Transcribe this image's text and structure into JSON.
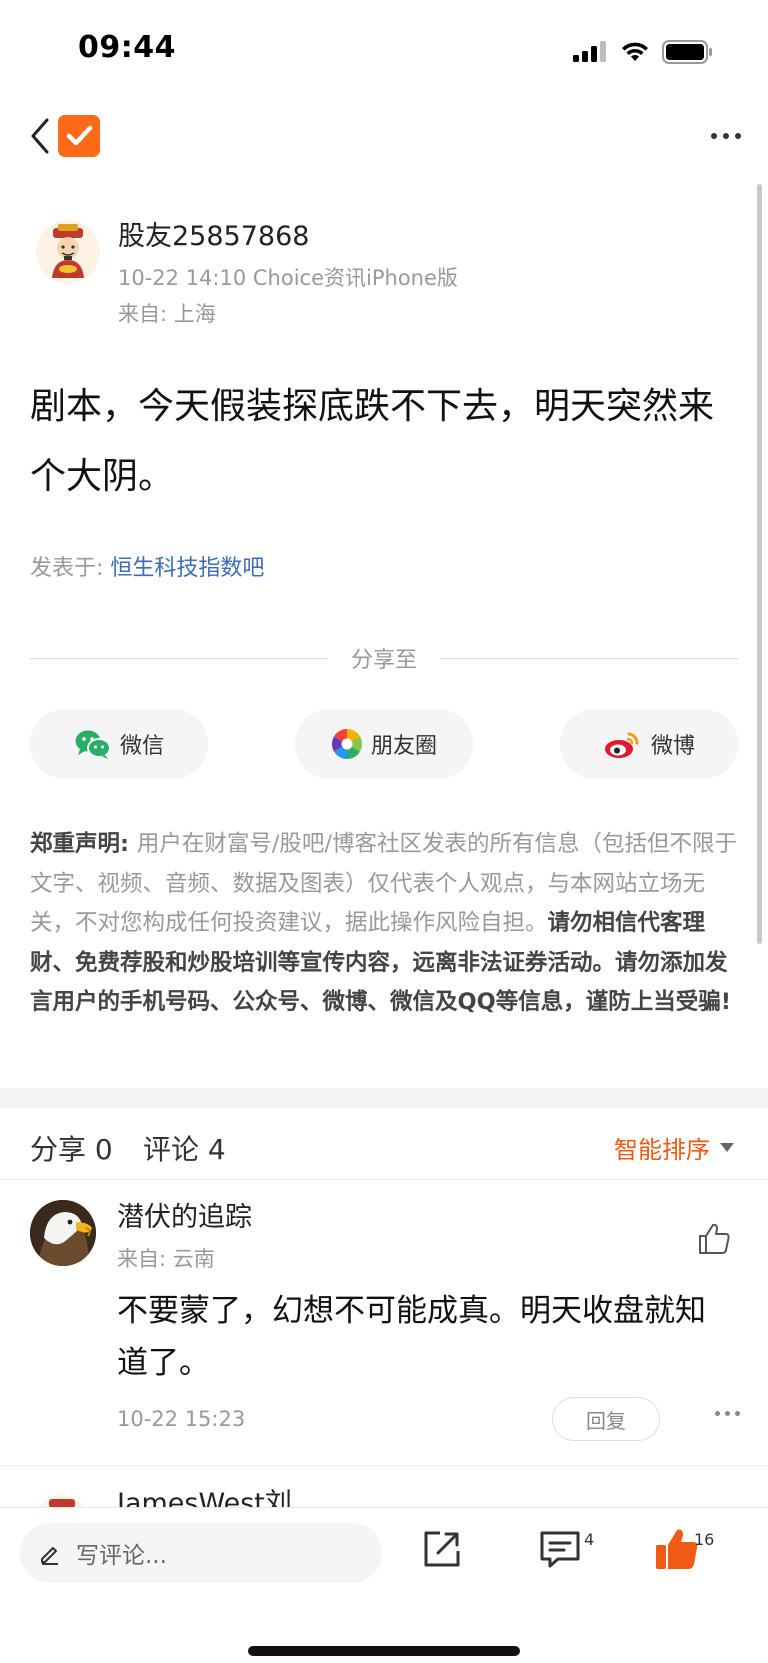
{
  "status_bar": {
    "time": "09:44"
  },
  "nav": {
    "back_icon": "chevron-left-icon",
    "logo_icon": "checkmark-logo-icon",
    "more_icon": "more-horizontal-icon"
  },
  "post": {
    "username": "股友25857868",
    "meta": "10-22 14:10 Choice资讯iPhone版",
    "location": "来自: 上海",
    "body": "剧本，今天假装探底跌不下去，明天突然来个大阴。",
    "posted_in_label": "发表于: ",
    "forum": "恒生科技指数吧"
  },
  "share": {
    "label": "分享至",
    "wechat": "微信",
    "moments": "朋友圈",
    "weibo": "微博"
  },
  "disclaimer": {
    "title": "郑重声明: ",
    "normal": "用户在财富号/股吧/博客社区发表的所有信息（包括但不限于文字、视频、音频、数据及图表）仅代表个人观点，与本网站立场无关，不对您构成任何投资建议，据此操作风险自担。",
    "bold": "请勿相信代客理财、免费荐股和炒股培训等宣传内容，远离非法证券活动。请勿添加发言用户的手机号码、公众号、微博、微信及QQ等信息，谨防上当受骗!"
  },
  "comments_header": {
    "share_count": "分享 0",
    "comment_count": "评论 4",
    "sort_label": "智能排序"
  },
  "comments": [
    {
      "username": "潜伏的追踪",
      "location": "来自: 云南",
      "text": "不要蒙了，幻想不可能成真。明天收盘就知道了。",
      "time": "10-22 15:23",
      "reply_label": "回复"
    },
    {
      "username": "JamesWest刘"
    }
  ],
  "bottom_bar": {
    "input_placeholder": "写评论...",
    "comment_badge": "4",
    "like_badge": "16"
  },
  "colors": {
    "accent": "#f05a14",
    "link": "#3c6cb8",
    "logo": "#ff6a1a"
  }
}
